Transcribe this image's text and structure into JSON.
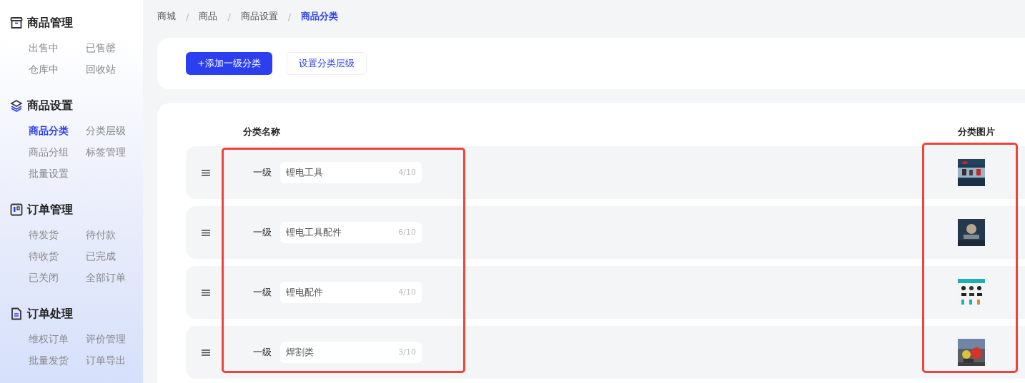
{
  "sidebar": {
    "groups": [
      {
        "title": "商品管理",
        "items": [
          {
            "label": "出售中",
            "selected": false
          },
          {
            "label": "已售罄",
            "selected": false
          },
          {
            "label": "仓库中",
            "selected": false
          },
          {
            "label": "回收站",
            "selected": false
          }
        ]
      },
      {
        "title": "商品设置",
        "items": [
          {
            "label": "商品分类",
            "selected": true
          },
          {
            "label": "分类层级",
            "selected": false
          },
          {
            "label": "商品分组",
            "selected": false
          },
          {
            "label": "标签管理",
            "selected": false
          },
          {
            "label": "批量设置",
            "selected": false
          }
        ]
      },
      {
        "title": "订单管理",
        "items": [
          {
            "label": "待发货",
            "selected": false
          },
          {
            "label": "待付款",
            "selected": false
          },
          {
            "label": "待收货",
            "selected": false
          },
          {
            "label": "已完成",
            "selected": false
          },
          {
            "label": "已关闭",
            "selected": false
          },
          {
            "label": "全部订单",
            "selected": false
          }
        ]
      },
      {
        "title": "订单处理",
        "items": [
          {
            "label": "维权订单",
            "selected": false
          },
          {
            "label": "评价管理",
            "selected": false
          },
          {
            "label": "批量发货",
            "selected": false
          },
          {
            "label": "订单导出",
            "selected": false
          }
        ]
      }
    ]
  },
  "breadcrumb": [
    {
      "label": "商城",
      "selected": false
    },
    {
      "label": "商品",
      "selected": false
    },
    {
      "label": "商品设置",
      "selected": false
    },
    {
      "label": "商品分类",
      "selected": true
    }
  ],
  "breadcrumb_separator": "/",
  "toolbar": {
    "buttons": [
      {
        "label": "+添加一级分类",
        "kind": "primary"
      },
      {
        "label": "设置分类层级",
        "kind": "secondary"
      }
    ]
  },
  "table": {
    "columns": [
      "分类名称",
      "分类图片"
    ],
    "rows": [
      {
        "tier": "一级",
        "name": "锂电工具",
        "count": "4/10"
      },
      {
        "tier": "一级",
        "name": "锂电工具配件",
        "count": "6/10"
      },
      {
        "tier": "一级",
        "name": "锂电配件",
        "count": "4/10"
      },
      {
        "tier": "一级",
        "name": "焊割类",
        "count": "3/10"
      }
    ]
  }
}
